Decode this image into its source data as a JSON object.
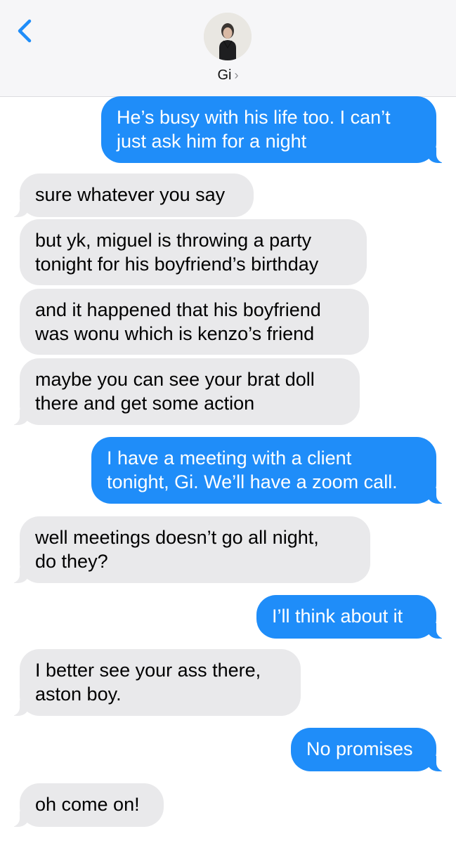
{
  "header": {
    "contact_name": "Gi",
    "chevron": "›",
    "back_icon": "chevron-left-icon",
    "accent_color": "#1f8df9"
  },
  "messages": [
    {
      "sender": "me",
      "text": "He’s busy with his life too. I can’t\njust ask him for a night"
    },
    {
      "sender": "contact",
      "text": "sure whatever you say"
    },
    {
      "sender": "contact",
      "text": "but yk, miguel is throwing a party\ntonight for his boyfriend’s birthday"
    },
    {
      "sender": "contact",
      "text": "and it happened that his boyfriend\nwas wonu which is kenzo’s friend"
    },
    {
      "sender": "contact",
      "text": "maybe you can see your brat doll\nthere and get some action"
    },
    {
      "sender": "me",
      "text": "I have a meeting with a client\ntonight, Gi. We’ll have a zoom call."
    },
    {
      "sender": "contact",
      "text": "well meetings doesn’t  go all night,\ndo they?"
    },
    {
      "sender": "me",
      "text": "I’ll think about it"
    },
    {
      "sender": "contact",
      "text": "I better see your ass there,\naston boy."
    },
    {
      "sender": "me",
      "text": "No promises"
    },
    {
      "sender": "contact",
      "text": "oh come on!"
    }
  ]
}
